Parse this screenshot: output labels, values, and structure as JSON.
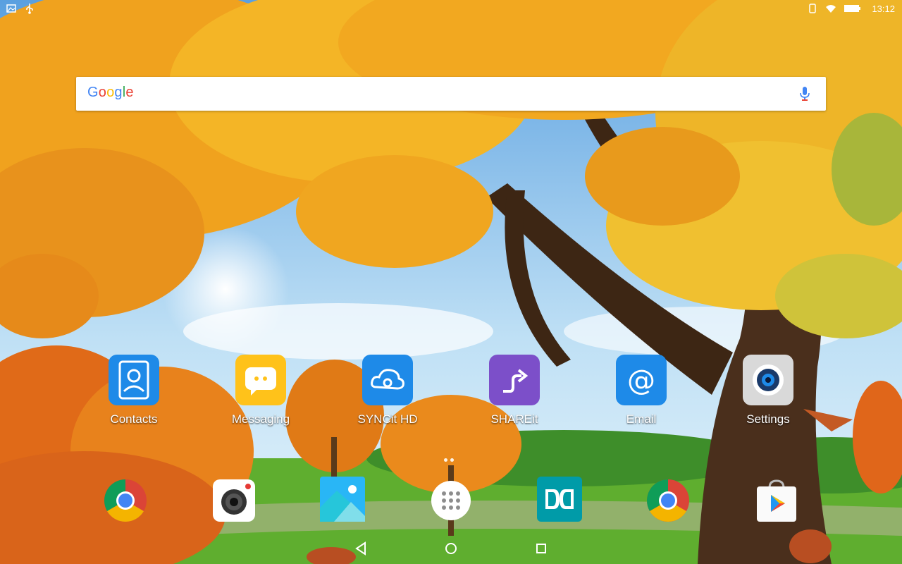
{
  "status_bar": {
    "time": "13:12",
    "left_icons": [
      "image-icon",
      "usb-icon"
    ],
    "right_icons": [
      "rotate-icon",
      "wifi-icon",
      "battery-icon"
    ]
  },
  "search": {
    "logo": {
      "G": "G",
      "o1": "o",
      "o2": "o",
      "g": "g",
      "l": "l",
      "e": "e"
    },
    "mic_icon": "mic-icon"
  },
  "apps": [
    {
      "label": "Contacts",
      "icon": "contacts-icon",
      "color": "#1E88E5"
    },
    {
      "label": "Messaging",
      "icon": "messaging-icon",
      "color": "#FFC107"
    },
    {
      "label": "SYNCit HD",
      "icon": "cloud-sync-icon",
      "color": "#1E88E5"
    },
    {
      "label": "SHAREit",
      "icon": "shareit-icon",
      "color": "#7E57C2"
    },
    {
      "label": "Email",
      "icon": "at-icon",
      "color": "#1E88E5"
    },
    {
      "label": "Settings",
      "icon": "gear-icon",
      "color": "#9E9E9E"
    }
  ],
  "dock": [
    {
      "name": "chrome-icon"
    },
    {
      "name": "camera-icon"
    },
    {
      "name": "gallery-icon"
    },
    {
      "name": "app-drawer-icon"
    },
    {
      "name": "dolby-icon"
    },
    {
      "name": "chrome-icon"
    },
    {
      "name": "play-store-icon"
    }
  ],
  "nav": {
    "back": "back-icon",
    "home": "home-icon",
    "recents": "recents-icon"
  }
}
